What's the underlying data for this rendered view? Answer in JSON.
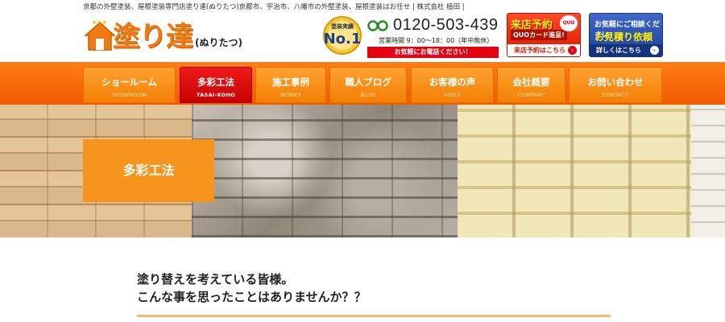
{
  "header": {
    "tagline": "京都の外壁塗装、屋根塗装専門店塗り達(ぬりたつ)京都市、宇治市、八幡市の外壁塗装、屋根塗装はお任せ | 株式会社 植田 |",
    "logo_main": "塗り達",
    "logo_sub": "(ぬりたつ)",
    "medal_top": "塗装実績",
    "medal_main": "No.1",
    "phone_number": "0120-503-439",
    "phone_hours": "営業時間 9：00～18：00（年中無休）",
    "phone_cta": "お気軽にお電話ください！"
  },
  "banners": {
    "visit_title": "来店予約",
    "visit_sub": "QUOカード進呈!",
    "visit_foot": "来店予約はこちら",
    "quo_badge": "QUO",
    "estimate_title": "お気軽にご相談ください",
    "estimate_sub": "お見積り依頼",
    "estimate_foot": "詳しくはこちら",
    "arrow_glyph": "›"
  },
  "nav": {
    "items": [
      {
        "ja": "ショールーム",
        "en": "SHOWROOM"
      },
      {
        "ja": "多彩工法",
        "en": "TASAI-KOHO"
      },
      {
        "ja": "施工事例",
        "en": "WORKS"
      },
      {
        "ja": "職人ブログ",
        "en": "BLOG"
      },
      {
        "ja": "お客様の声",
        "en": "VOICE"
      },
      {
        "ja": "会社概要",
        "en": "COMPANY"
      },
      {
        "ja": "お問い合わせ",
        "en": "CONTACT"
      }
    ],
    "active_index": 1
  },
  "hero": {
    "title": "多彩工法"
  },
  "content": {
    "intro_line1": "塗り替えを考えている皆様。",
    "intro_line2": "こんな事を思ったことはありませんか？？"
  },
  "colors": {
    "brand_orange": "#f07a12",
    "nav_active_red": "#c90000",
    "phone_red": "#e60012",
    "estimate_blue": "#1e3f98"
  }
}
